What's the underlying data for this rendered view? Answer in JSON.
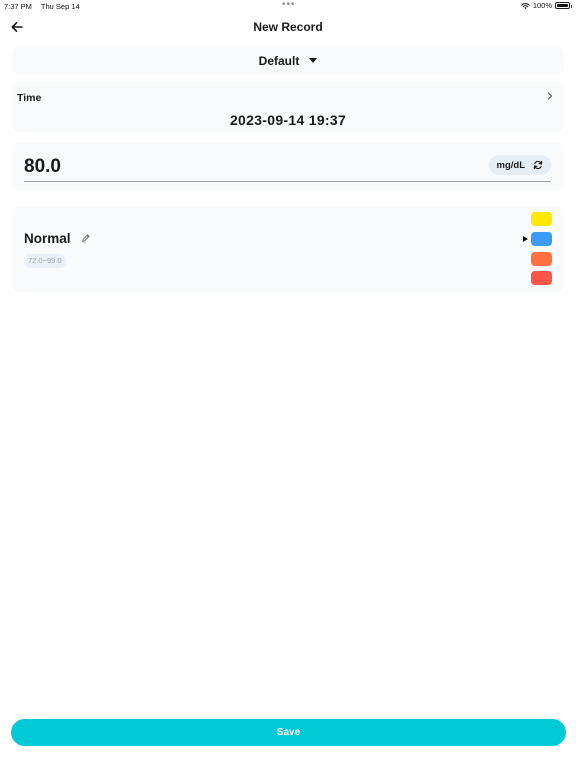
{
  "status_bar": {
    "time": "7:37 PM",
    "date": "Thu Sep 14",
    "battery": "100%",
    "battery_level": 1.0
  },
  "nav": {
    "title": "New Record",
    "back_icon": "arrow-left-icon"
  },
  "profile": {
    "selected": "Default"
  },
  "time": {
    "label": "Time",
    "value": "2023-09-14 19:37"
  },
  "reading": {
    "value": "80.0",
    "unit": "mg/dL"
  },
  "status": {
    "name": "Normal",
    "range": "72.0~99.0",
    "selected_index": 1,
    "swatches": [
      {
        "color": "#ffe800"
      },
      {
        "color": "#3a9cf6"
      },
      {
        "color": "#ff7040"
      },
      {
        "color": "#fb5547"
      }
    ]
  },
  "footer": {
    "save_label": "Save",
    "save_color": "#00cad6"
  }
}
